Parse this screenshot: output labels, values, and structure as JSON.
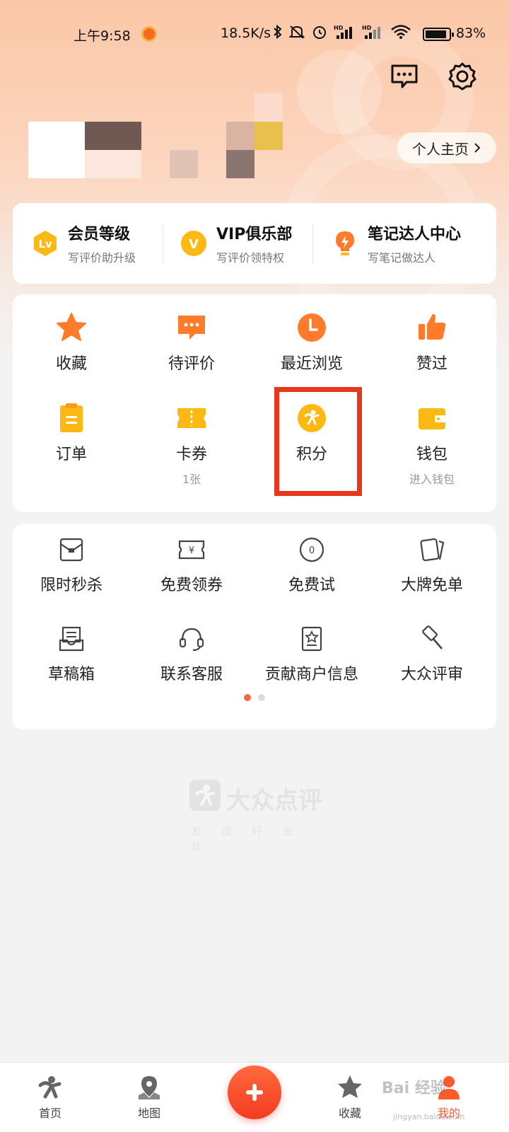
{
  "status_bar": {
    "time": "上午9:58",
    "net_speed": "18.5K/s",
    "battery_percent": "83%",
    "battery_level": 0.83,
    "icons": [
      "bluetooth-icon",
      "mute-icon",
      "alarm-icon",
      "hd-signal-icon",
      "hd-signal-icon",
      "wifi-icon",
      "battery-icon"
    ]
  },
  "header": {
    "message_icon": "message-icon",
    "settings_icon": "settings-icon",
    "profile_home_label": "个人主页"
  },
  "member": {
    "items": [
      {
        "title": "会员等级",
        "sub": "写评价助升级",
        "icon": "level-badge-icon",
        "badge": "Lv"
      },
      {
        "title": "VIP俱乐部",
        "sub": "写评价领特权",
        "icon": "vip-badge-icon",
        "badge": "V"
      },
      {
        "title": "笔记达人中心",
        "sub": "写笔记做达人",
        "icon": "lightbulb-icon"
      }
    ]
  },
  "grid": {
    "items": [
      {
        "label": "收藏",
        "sub": "",
        "icon": "star-icon"
      },
      {
        "label": "待评价",
        "sub": "",
        "icon": "comment-icon"
      },
      {
        "label": "最近浏览",
        "sub": "",
        "icon": "clock-icon"
      },
      {
        "label": "赞过",
        "sub": "",
        "icon": "thumbs-up-icon"
      },
      {
        "label": "订单",
        "sub": "",
        "icon": "order-clipboard-icon"
      },
      {
        "label": "卡券",
        "sub": "1张",
        "icon": "ticket-icon"
      },
      {
        "label": "积分",
        "sub": "",
        "icon": "points-icon"
      },
      {
        "label": "钱包",
        "sub": "进入钱包",
        "icon": "wallet-icon"
      }
    ]
  },
  "tools": {
    "items": [
      {
        "label": "限时秒杀",
        "icon": "flash-sale-icon"
      },
      {
        "label": "免费领券",
        "icon": "coupon-icon"
      },
      {
        "label": "免费试",
        "icon": "free-trial-icon"
      },
      {
        "label": "大牌免单",
        "icon": "free-order-icon"
      },
      {
        "label": "草稿箱",
        "icon": "drafts-icon"
      },
      {
        "label": "联系客服",
        "icon": "headset-icon"
      },
      {
        "label": "贡献商户信息",
        "icon": "contribute-icon"
      },
      {
        "label": "大众评审",
        "icon": "gavel-icon"
      }
    ],
    "page_count": 2,
    "current_page": 1
  },
  "watermark": {
    "brand": "大众点评",
    "slogan": "发现好去处"
  },
  "tab_bar": {
    "tabs": [
      {
        "label": "首页",
        "icon": "home-icon"
      },
      {
        "label": "地图",
        "icon": "map-pin-icon"
      },
      {
        "label": "收藏",
        "icon": "star-tab-icon"
      },
      {
        "label": "我的",
        "icon": "profile-icon"
      }
    ],
    "add_icon": "plus-icon"
  },
  "overlay_watermark": {
    "text": "Bai 经验",
    "sub": "jingyan.baidu.com"
  },
  "colors": {
    "accent": "#ff6633",
    "highlight_box": "#e8361c",
    "icon_orange": "#fd7b2a",
    "icon_yellow": "#fdb913"
  }
}
